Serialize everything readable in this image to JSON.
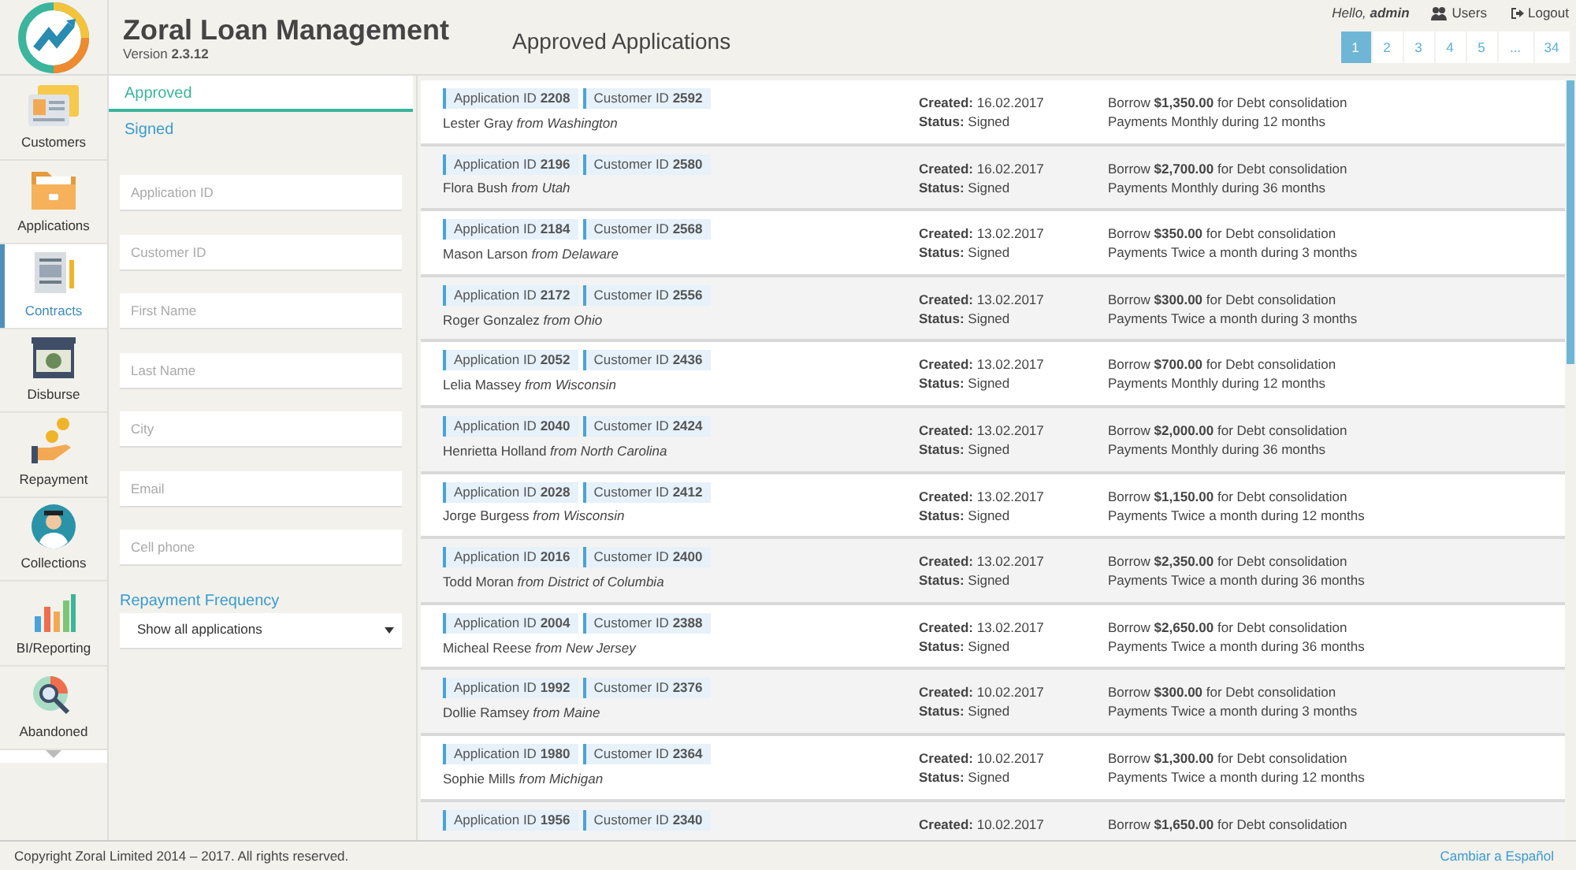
{
  "header": {
    "app_title": "Zoral Loan Management",
    "version": "Version **2.3.12**",
    "page_title": "Approved Applications",
    "greeting": "Hello, **admin**",
    "links": [
      {
        "kind": "users",
        "label": "Users"
      },
      {
        "kind": "logout",
        "label": "Logout"
      }
    ],
    "pagination": [
      {
        "label": "1",
        "selected": true
      },
      {
        "label": "2",
        "selected": false
      },
      {
        "label": "3",
        "selected": false
      },
      {
        "label": "4",
        "selected": false
      },
      {
        "label": "5",
        "selected": false
      },
      {
        "label": "...",
        "selected": false
      },
      {
        "label": "34",
        "selected": false
      }
    ]
  },
  "sidebar": {
    "items": [
      {
        "kind": "customers",
        "label": "Customers",
        "selected": false
      },
      {
        "kind": "applications",
        "label": "Applications",
        "selected": false
      },
      {
        "kind": "contracts",
        "label": "Contracts",
        "selected": true
      },
      {
        "kind": "disburse",
        "label": "Disburse",
        "selected": false
      },
      {
        "kind": "repayment",
        "label": "Repayment",
        "selected": false
      },
      {
        "kind": "collections",
        "label": "Collections",
        "selected": false
      },
      {
        "kind": "reporting",
        "label": "BI/Reporting",
        "selected": false
      },
      {
        "kind": "abandoned",
        "label": "Abandoned",
        "selected": false
      }
    ]
  },
  "filters": {
    "tabs": [
      {
        "label": "Approved",
        "selected": true
      },
      {
        "label": "Signed",
        "selected": false
      }
    ],
    "fields": [
      {
        "placeholder": "Application ID"
      },
      {
        "placeholder": "Customer ID"
      },
      {
        "placeholder": "First Name"
      },
      {
        "placeholder": "Last Name"
      },
      {
        "placeholder": "City"
      },
      {
        "placeholder": "Email"
      },
      {
        "placeholder": "Cell phone"
      }
    ],
    "frequency_label": "Repayment Frequency",
    "frequency_value": "Show all applications"
  },
  "applications": [
    {
      "application_id": "Application ID **2208**",
      "customer_id": "Customer ID **2592**",
      "customer": "Lester Gray *from Washington*",
      "created": "**Created:** 16.02.2017",
      "status": "**Status:** Signed",
      "loan": "Borrow **$1,350.00** for Debt consolidation",
      "payments": "Payments Monthly during 12 months"
    },
    {
      "application_id": "Application ID **2196**",
      "customer_id": "Customer ID **2580**",
      "customer": "Flora Bush *from Utah*",
      "created": "**Created:** 16.02.2017",
      "status": "**Status:** Signed",
      "loan": "Borrow **$2,700.00** for Debt consolidation",
      "payments": "Payments Monthly during 36 months"
    },
    {
      "application_id": "Application ID **2184**",
      "customer_id": "Customer ID **2568**",
      "customer": "Mason Larson *from Delaware*",
      "created": "**Created:** 13.02.2017",
      "status": "**Status:** Signed",
      "loan": "Borrow **$350.00** for Debt consolidation",
      "payments": "Payments Twice a month during 3 months"
    },
    {
      "application_id": "Application ID **2172**",
      "customer_id": "Customer ID **2556**",
      "customer": "Roger Gonzalez *from Ohio*",
      "created": "**Created:** 13.02.2017",
      "status": "**Status:** Signed",
      "loan": "Borrow **$300.00** for Debt consolidation",
      "payments": "Payments Twice a month during 3 months"
    },
    {
      "application_id": "Application ID **2052**",
      "customer_id": "Customer ID **2436**",
      "customer": "Lelia Massey *from Wisconsin*",
      "created": "**Created:** 13.02.2017",
      "status": "**Status:** Signed",
      "loan": "Borrow **$700.00** for Debt consolidation",
      "payments": "Payments Monthly during 12 months"
    },
    {
      "application_id": "Application ID **2040**",
      "customer_id": "Customer ID **2424**",
      "customer": "Henrietta Holland *from North Carolina*",
      "created": "**Created:** 13.02.2017",
      "status": "**Status:** Signed",
      "loan": "Borrow **$2,000.00** for Debt consolidation",
      "payments": "Payments Monthly during 36 months"
    },
    {
      "application_id": "Application ID **2028**",
      "customer_id": "Customer ID **2412**",
      "customer": "Jorge Burgess *from Wisconsin*",
      "created": "**Created:** 13.02.2017",
      "status": "**Status:** Signed",
      "loan": "Borrow **$1,150.00** for Debt consolidation",
      "payments": "Payments Twice a month during 12 months"
    },
    {
      "application_id": "Application ID **2016**",
      "customer_id": "Customer ID **2400**",
      "customer": "Todd Moran *from District of Columbia*",
      "created": "**Created:** 13.02.2017",
      "status": "**Status:** Signed",
      "loan": "Borrow **$2,350.00** for Debt consolidation",
      "payments": "Payments Twice a month during 36 months"
    },
    {
      "application_id": "Application ID **2004**",
      "customer_id": "Customer ID **2388**",
      "customer": "Micheal Reese *from New Jersey*",
      "created": "**Created:** 13.02.2017",
      "status": "**Status:** Signed",
      "loan": "Borrow **$2,650.00** for Debt consolidation",
      "payments": "Payments Twice a month during 36 months"
    },
    {
      "application_id": "Application ID **1992**",
      "customer_id": "Customer ID **2376**",
      "customer": "Dollie Ramsey *from Maine*",
      "created": "**Created:** 10.02.2017",
      "status": "**Status:** Signed",
      "loan": "Borrow **$300.00** for Debt consolidation",
      "payments": "Payments Twice a month during 3 months"
    },
    {
      "application_id": "Application ID **1980**",
      "customer_id": "Customer ID **2364**",
      "customer": "Sophie Mills *from Michigan*",
      "created": "**Created:** 10.02.2017",
      "status": "**Status:** Signed",
      "loan": "Borrow **$1,300.00** for Debt consolidation",
      "payments": "Payments Twice a month during 12 months"
    },
    {
      "application_id": "Application ID **1956**",
      "customer_id": "Customer ID **2340**",
      "created": "**Created:** 10.02.2017",
      "loan": "Borrow **$1,650.00** for Debt consolidation"
    }
  ],
  "footer": {
    "copyright": "Copyright Zoral Limited 2014 – 2017. All rights reserved.",
    "language_link": "Cambiar a Español"
  }
}
